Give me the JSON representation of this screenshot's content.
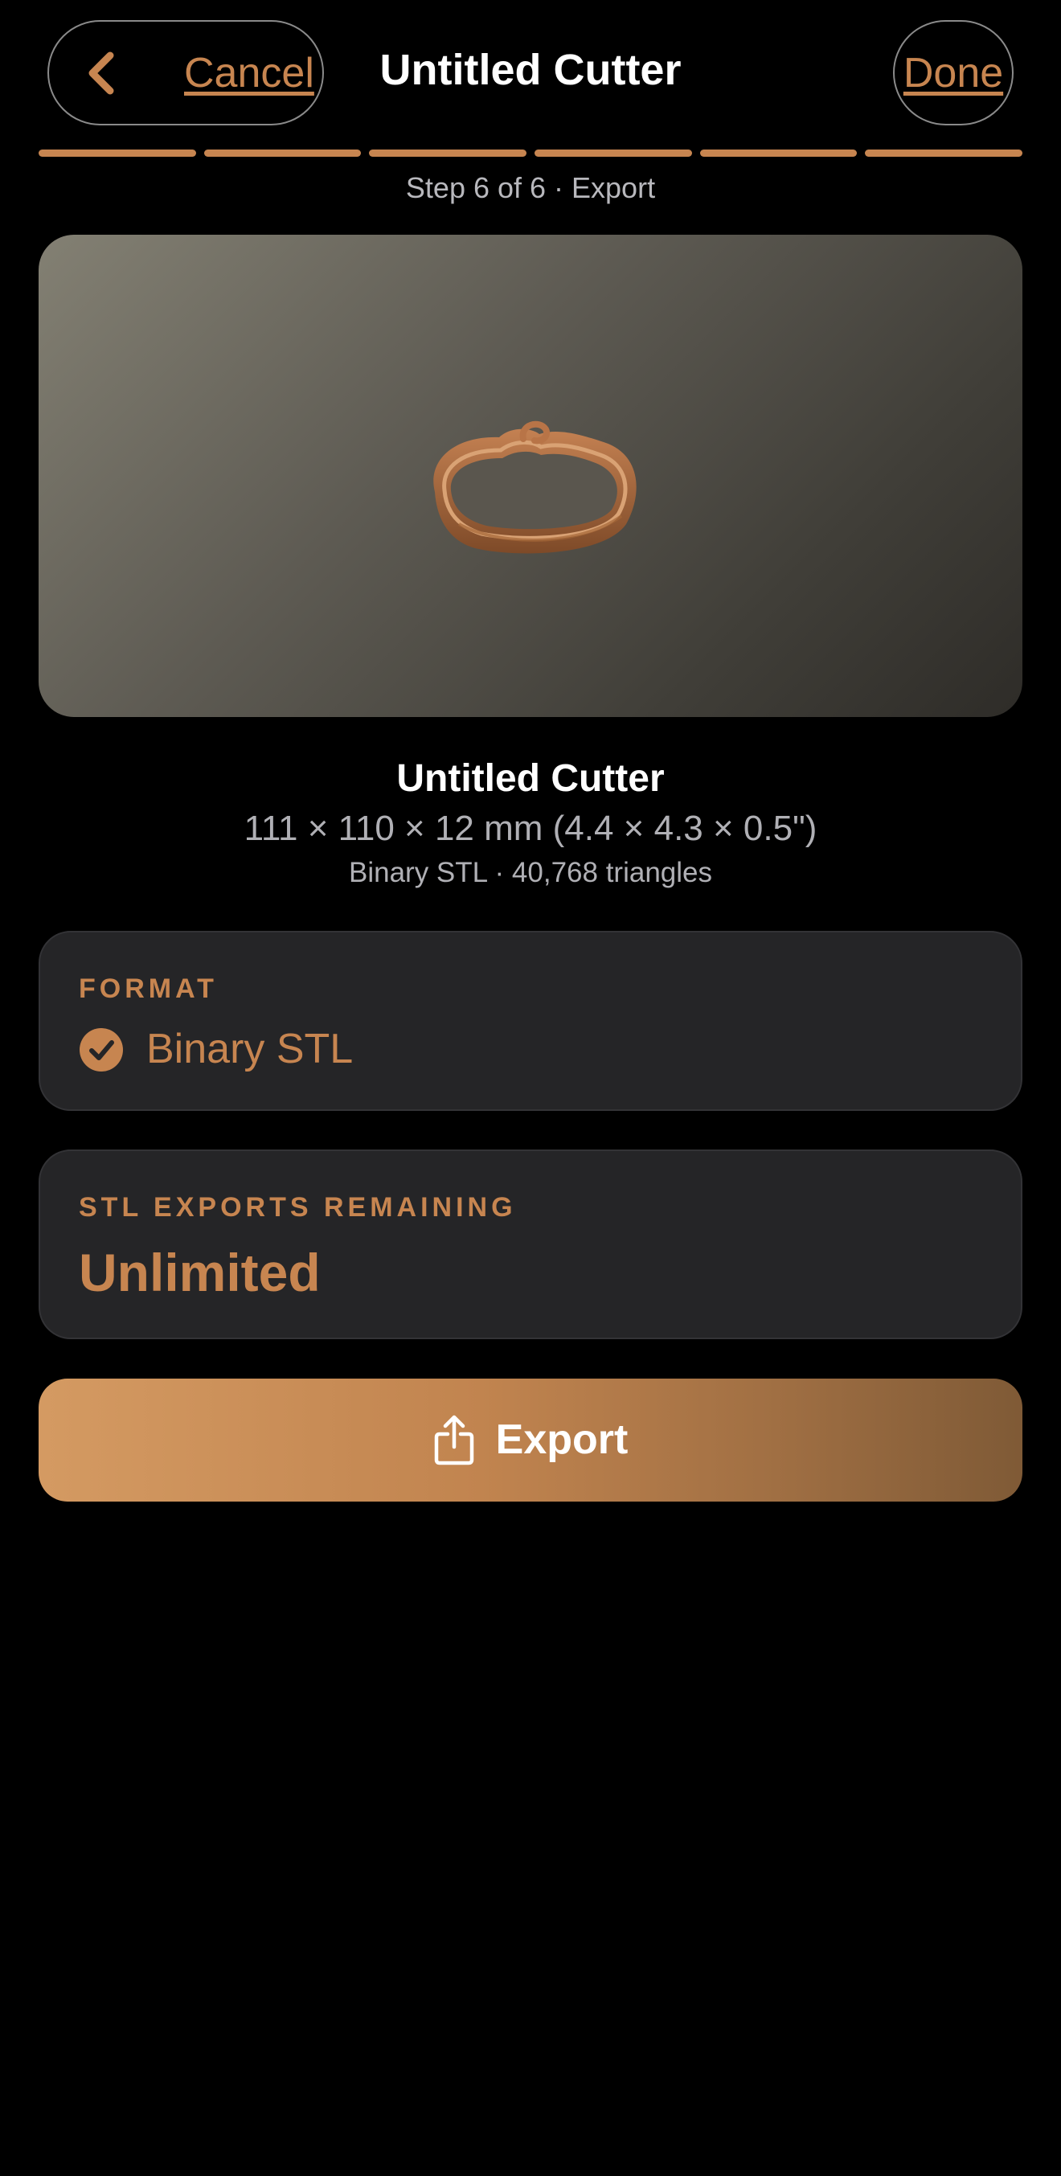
{
  "header": {
    "cancel_label": "Cancel",
    "title": "Untitled Cutter",
    "done_label": "Done",
    "back_icon": "chevron-left-icon"
  },
  "progress": {
    "current_step": 6,
    "total_steps": 6,
    "step_text": "Step 6 of 6 · Export"
  },
  "model": {
    "name": "Untitled Cutter",
    "dimensions": "111 × 110 × 12 mm (4.4 × 4.3 × 0.5\")",
    "meta": "Binary STL · 40,768 triangles"
  },
  "format_card": {
    "label": "FORMAT",
    "value": "Binary STL",
    "icon": "checkmark-circle-icon"
  },
  "exports_card": {
    "label": "STL EXPORTS REMAINING",
    "value": "Unlimited"
  },
  "export_button": {
    "label": "Export",
    "icon": "share-icon"
  },
  "colors": {
    "accent": "#c78550",
    "background": "#000000",
    "card": "#252527",
    "muted_text": "#b0b0b5"
  }
}
